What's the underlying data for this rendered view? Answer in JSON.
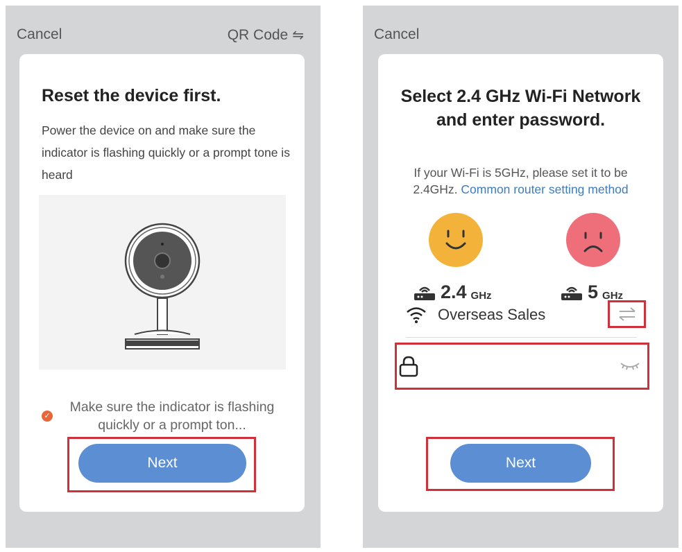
{
  "screen1": {
    "cancel_label": "Cancel",
    "qr_label": "QR Code",
    "title": "Reset the device first.",
    "description": "Power the device on and make sure the indicator is flashing quickly or a prompt tone is heard",
    "confirm_text": "Make sure the indicator is flashing quickly or a prompt ton...",
    "next_label": "Next"
  },
  "screen2": {
    "cancel_label": "Cancel",
    "title": "Select 2.4 GHz Wi-Fi Network and enter password.",
    "hint_prefix": "If your Wi-Fi is 5GHz, please set it to be 2.4GHz.",
    "hint_link": "Common router setting method",
    "band_24_value": "2.4",
    "band_24_unit": "GHz",
    "band_5_value": "5",
    "band_5_unit": "GHz",
    "ssid": "Overseas Sales",
    "password_value": "",
    "next_label": "Next"
  },
  "colors": {
    "accent": "#5b8ed2",
    "highlight": "#d0303a",
    "check": "#e8673a",
    "good": "#f3b33a",
    "bad": "#ee6f79"
  }
}
